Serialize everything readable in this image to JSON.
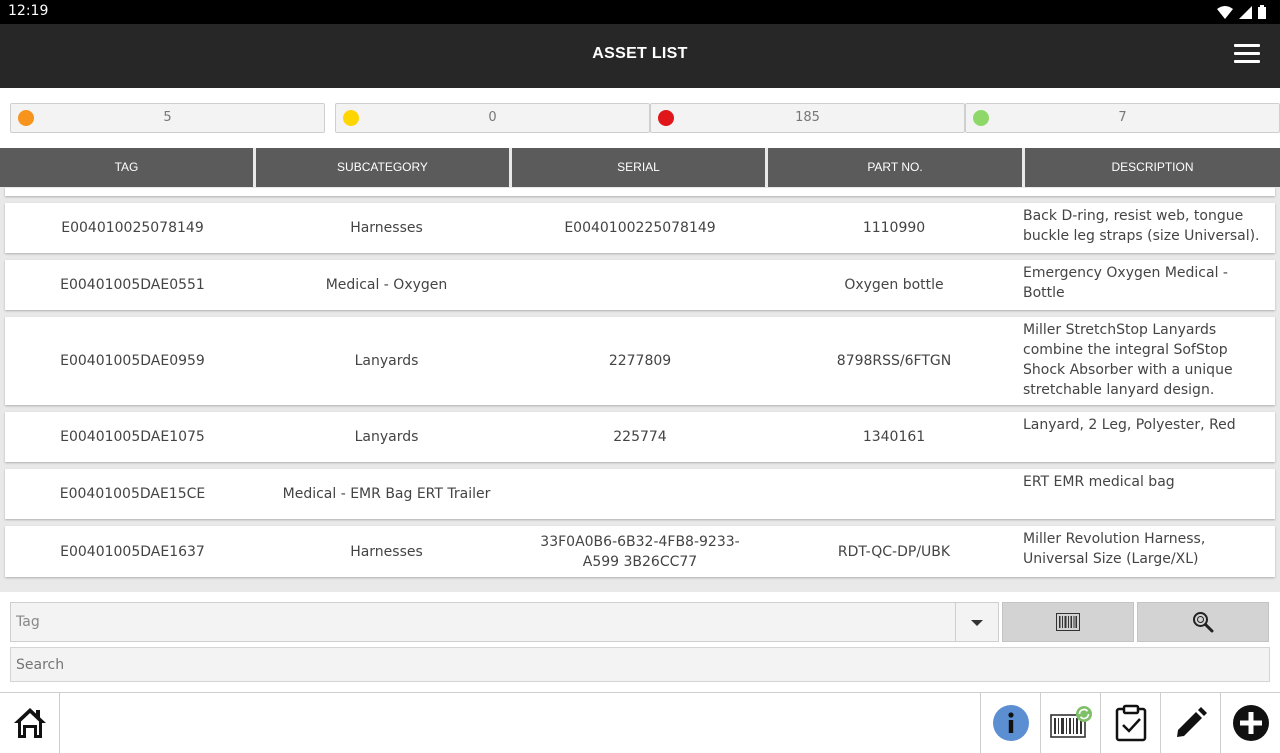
{
  "status_bar": {
    "time": "12:19"
  },
  "app_bar": {
    "title": "ASSET LIST"
  },
  "counters": [
    {
      "color": "#f7941d",
      "value": "5"
    },
    {
      "color": "#ffd500",
      "value": "0"
    },
    {
      "color": "#e0161b",
      "value": "185"
    },
    {
      "color": "#8ed86a",
      "value": "7"
    }
  ],
  "table": {
    "columns": [
      "TAG",
      "SUBCATEGORY",
      "SERIAL",
      "PART NO.",
      "DESCRIPTION"
    ],
    "rows": [
      {
        "tag": "E004010025078149",
        "subcategory": "Harnesses",
        "serial": "E0040100225078149",
        "part_no": "1110990",
        "description": "Back D-ring, resist web, tongue buckle leg straps (size Universal)."
      },
      {
        "tag": "E00401005DAE0551",
        "subcategory": "Medical - Oxygen",
        "serial": "",
        "part_no": "Oxygen bottle",
        "description": "Emergency Oxygen Medical - Bottle"
      },
      {
        "tag": "E00401005DAE0959",
        "subcategory": "Lanyards",
        "serial": "2277809",
        "part_no": "8798RSS/6FTGN",
        "description": "Miller StretchStop Lanyards combine the integral SofStop Shock Absorber with a unique stretchable lanyard design."
      },
      {
        "tag": "E00401005DAE1075",
        "subcategory": "Lanyards",
        "serial": "225774",
        "part_no": "1340161",
        "description": "Lanyard, 2 Leg, Polyester, Red"
      },
      {
        "tag": "E00401005DAE15CE",
        "subcategory": "Medical - EMR Bag ERT Trailer",
        "serial": "",
        "part_no": "",
        "description": "ERT EMR medical bag"
      },
      {
        "tag": "E00401005DAE1637",
        "subcategory": "Harnesses",
        "serial": "33F0A0B6-6B32-4FB8-9233-A599 3B26CC77",
        "part_no": "RDT-QC-DP/UBK",
        "description": "Miller Revolution Harness, Universal Size (Large/XL)"
      }
    ]
  },
  "search": {
    "tag_placeholder": "Tag",
    "search_placeholder": "Search"
  },
  "bottom_nav": {
    "icons": [
      "home-icon",
      "info-icon",
      "barcode-sync-icon",
      "clipboard-check-icon",
      "pencil-icon",
      "add-circle-icon"
    ]
  }
}
